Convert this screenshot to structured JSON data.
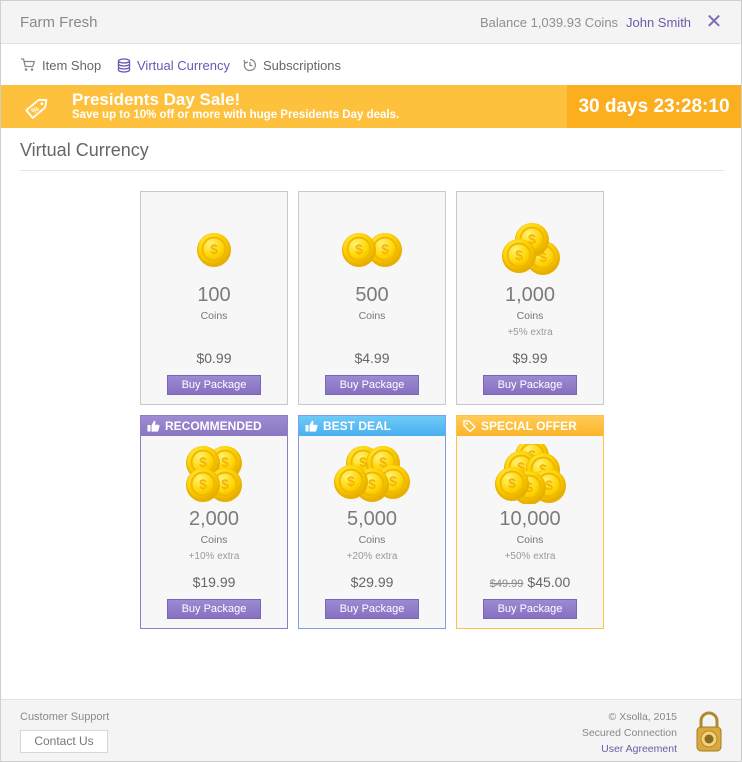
{
  "header": {
    "app_title": "Farm Fresh",
    "balance": "Balance 1,039.93 Coins",
    "user_name": "John Smith",
    "close": "✕"
  },
  "nav": {
    "items": [
      {
        "label": "Item Shop",
        "icon": "cart-icon",
        "active": false
      },
      {
        "label": "Virtual Currency",
        "icon": "coin-stack-icon",
        "active": true
      },
      {
        "label": "Subscriptions",
        "icon": "clock-refresh-icon",
        "active": false
      }
    ]
  },
  "banner": {
    "title": "Presidents Day Sale!",
    "subtitle": "Save up to 10% off or more with huge Presidents Day deals.",
    "countdown": "30 days 23:28:10",
    "icon": "discount-tag-icon",
    "color": "#fec13d"
  },
  "section": {
    "title": "Virtual Currency"
  },
  "packages": [
    {
      "amount": "100",
      "unit": "Coins",
      "extra": "",
      "price": "$0.99",
      "old_price": "",
      "badge": "",
      "buy": "Buy Package"
    },
    {
      "amount": "500",
      "unit": "Coins",
      "extra": "",
      "price": "$4.99",
      "old_price": "",
      "badge": "",
      "buy": "Buy Package"
    },
    {
      "amount": "1,000",
      "unit": "Coins",
      "extra": "+5% extra",
      "price": "$9.99",
      "old_price": "",
      "badge": "",
      "buy": "Buy Package"
    },
    {
      "amount": "2,000",
      "unit": "Coins",
      "extra": "+10% extra",
      "price": "$19.99",
      "old_price": "",
      "badge": "RECOMMENDED",
      "buy": "Buy Package"
    },
    {
      "amount": "5,000",
      "unit": "Coins",
      "extra": "+20% extra",
      "price": "$29.99",
      "old_price": "",
      "badge": "BEST DEAL",
      "buy": "Buy Package"
    },
    {
      "amount": "10,000",
      "unit": "Coins",
      "extra": "+50% extra",
      "price": "$45.00",
      "old_price": "$49.99",
      "badge": "SPECIAL OFFER",
      "buy": "Buy Package"
    }
  ],
  "footer": {
    "support_label": "Customer Support",
    "contact_button": "Contact Us",
    "copyright": "© Xsolla, 2015",
    "secured": "Secured Connection",
    "agreement": "User Agreement"
  },
  "colors": {
    "accent": "#7e69b8",
    "banner": "#fec13d",
    "countdown_bg": "#fbae1e",
    "coin": "#f7c900"
  }
}
